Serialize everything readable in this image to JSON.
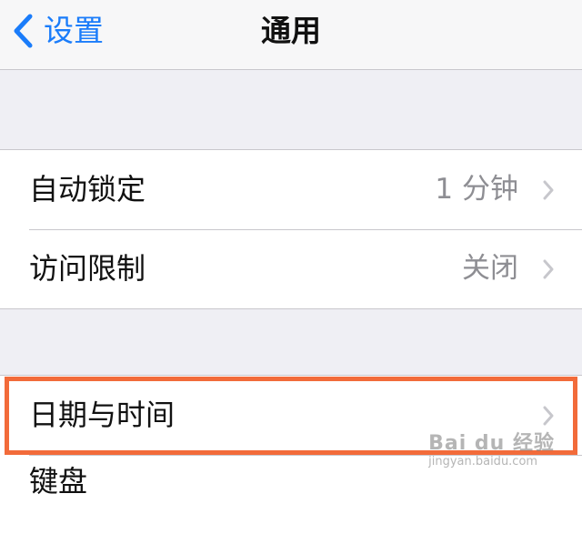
{
  "navbar": {
    "back_label": "设置",
    "title": "通用"
  },
  "group1": {
    "items": [
      {
        "label": "自动锁定",
        "value": "1 分钟"
      },
      {
        "label": "访问限制",
        "value": "关闭"
      }
    ]
  },
  "group2": {
    "items": [
      {
        "label": "日期与时间",
        "value": ""
      },
      {
        "label": "键盘",
        "value": ""
      }
    ]
  },
  "colors": {
    "accent": "#1a7cfa",
    "highlight": "#f26b3a",
    "background": "#efeff4"
  },
  "icons": {
    "back": "chevron-left-icon",
    "disclosure": "chevron-right-icon"
  },
  "watermark": {
    "line1": "Bai du 经验",
    "line2": "jingyan.baidu.com"
  }
}
